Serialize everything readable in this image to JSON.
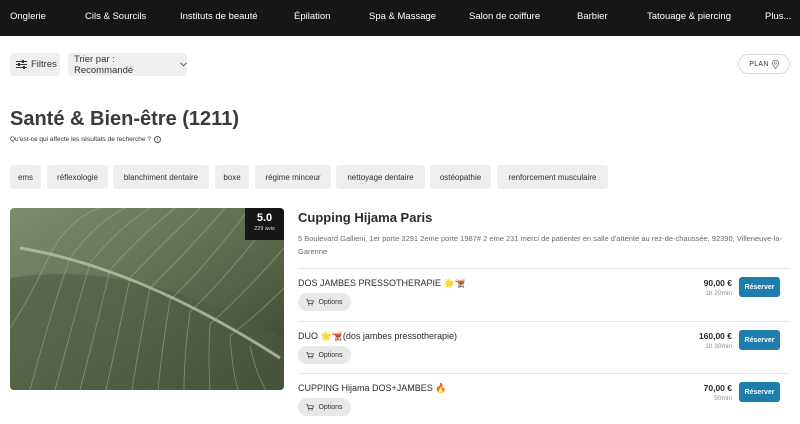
{
  "nav": {
    "items": [
      "Onglerie",
      "Cils & Sourcils",
      "Instituts de beauté",
      "Épilation",
      "Spa & Massage",
      "Salon de coiffure",
      "Barbier",
      "Tatouage & piercing",
      "Plus..."
    ]
  },
  "toolbar": {
    "filters_label": "Filtres",
    "sort_label": "Trier par : Recommandé",
    "map_label": "PLAN"
  },
  "page": {
    "title": "Santé & Bien-être (1211)",
    "subtitle": "Qu'est-ce qui affecte les résultats de recherche ?"
  },
  "tags": [
    "ems",
    "réflexologie",
    "blanchiment dentaire",
    "boxe",
    "régime minceur",
    "nettoyage dentaire",
    "ostéopathie",
    "renforcement musculaire"
  ],
  "salon": {
    "name": "Cupping Hijama Paris",
    "address": "5 Boulevard Gallieni, 1er porte 3291 2eme porte 1987# 2 eme 231 merci de patienter en salle d'attente au rez-de-chaussée, 92390, Villeneuve-la-Garenne",
    "rating": "5.0",
    "reviews": "229 avis",
    "services": [
      {
        "name": "DOS JAMBES PRESSOTHERAPIE 🌟🫕",
        "price": "90,00 €",
        "duration": "1h 20min",
        "options_label": "Options",
        "book_label": "Réserver"
      },
      {
        "name": "DUO 🌟🫕(dos jambes pressotherapie)",
        "price": "160,00 €",
        "duration": "1h 30min",
        "options_label": "Options",
        "book_label": "Réserver"
      },
      {
        "name": "CUPPING Hijama DOS+JAMBES 🔥",
        "price": "70,00 €",
        "duration": "50min",
        "options_label": "Options",
        "book_label": "Réserver"
      }
    ]
  },
  "colors": {
    "nav_bg": "#161616",
    "accent": "#1e7dab"
  }
}
